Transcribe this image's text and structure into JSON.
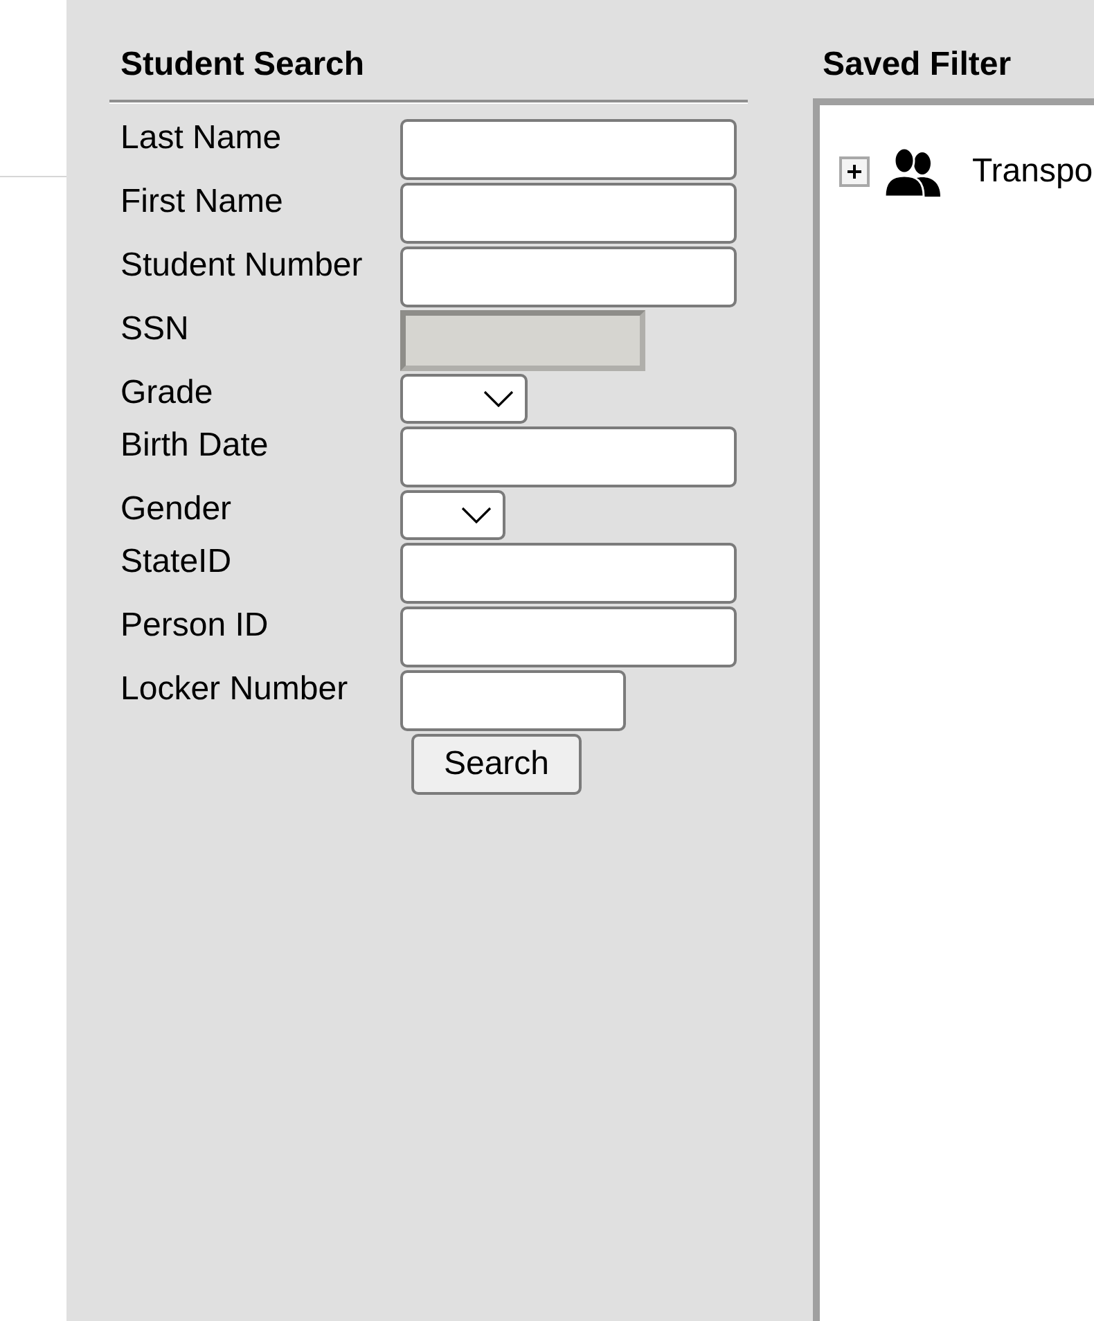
{
  "student_search": {
    "title": "Student Search",
    "fields": [
      {
        "label": "Last Name",
        "kind": "text",
        "disabled": false
      },
      {
        "label": "First Name",
        "kind": "text",
        "disabled": false
      },
      {
        "label": "Student Number",
        "kind": "text",
        "disabled": false
      },
      {
        "label": "SSN",
        "kind": "text",
        "disabled": true
      },
      {
        "label": "Grade",
        "kind": "select",
        "disabled": false
      },
      {
        "label": "Birth Date",
        "kind": "text",
        "disabled": false
      },
      {
        "label": "Gender",
        "kind": "select",
        "disabled": false
      },
      {
        "label": "StateID",
        "kind": "text",
        "disabled": false
      },
      {
        "label": "Person ID",
        "kind": "text",
        "disabled": false
      },
      {
        "label": "Locker Number",
        "kind": "text",
        "disabled": false
      }
    ],
    "button": "Search"
  },
  "saved_filter": {
    "title": "Saved Filter",
    "items": [
      {
        "label": "Transpo",
        "expanded": false
      }
    ]
  }
}
